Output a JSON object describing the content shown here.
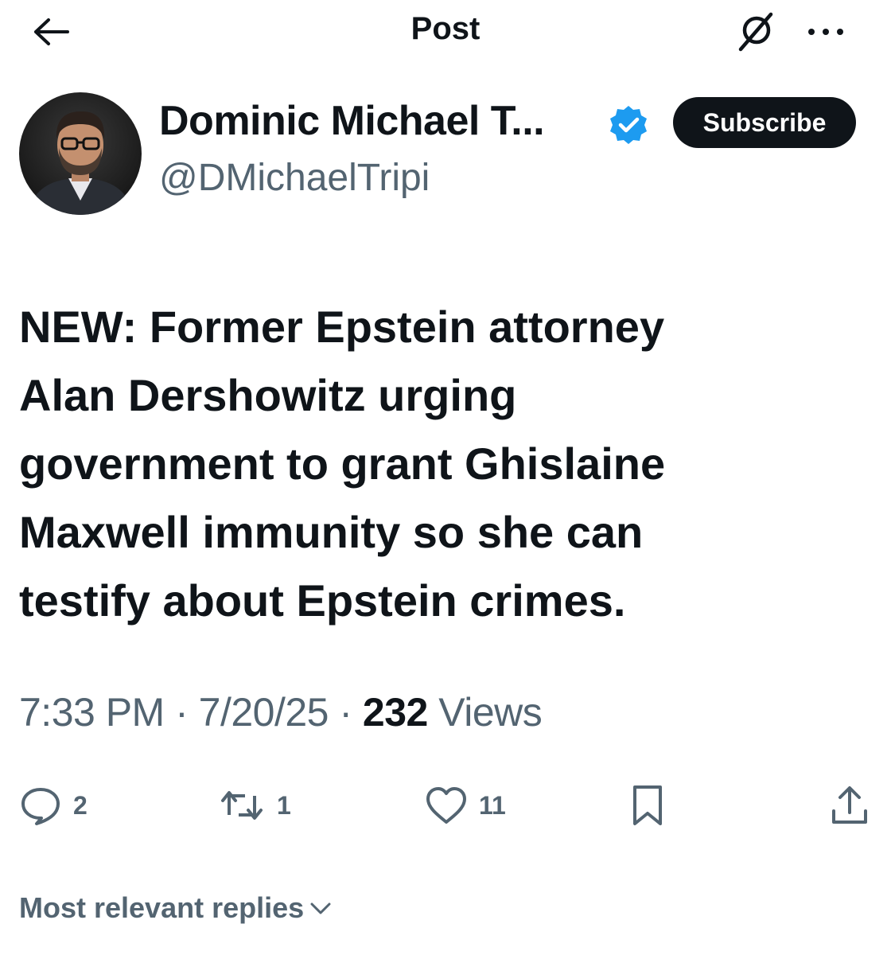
{
  "header": {
    "title": "Post"
  },
  "author": {
    "display_name": "Dominic Michael T...",
    "handle": "@DMichaelTripi",
    "verified": true,
    "subscribe_label": "Subscribe"
  },
  "post": {
    "text_lines": [
      "NEW: Former Epstein attorney",
      "Alan Dershowitz urging",
      "government to grant Ghislaine",
      "Maxwell immunity so she can",
      "testify about Epstein crimes."
    ],
    "time": "7:33 PM",
    "date": "7/20/25",
    "views_count": "232",
    "views_label": "Views"
  },
  "actions": {
    "reply_count": "2",
    "repost_count": "1",
    "like_count": "11"
  },
  "replies": {
    "sort_label": "Most relevant replies"
  },
  "colors": {
    "text": "#0f1419",
    "secondary": "#536471",
    "verified_badge": "#1d9bf0"
  },
  "icons": [
    "back-arrow-icon",
    "grok-icon",
    "more-icon",
    "verified-badge-icon",
    "reply-icon",
    "repost-icon",
    "like-icon",
    "bookmark-icon",
    "share-icon",
    "chevron-down-icon"
  ]
}
